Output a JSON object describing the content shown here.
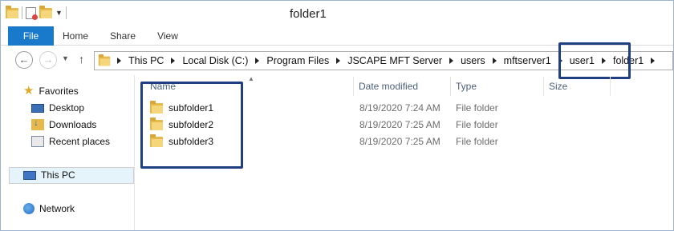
{
  "window": {
    "title": "folder1"
  },
  "ribbon": {
    "tabs": [
      "File",
      "Home",
      "Share",
      "View"
    ]
  },
  "address": {
    "crumbs": [
      "This PC",
      "Local Disk (C:)",
      "Program Files",
      "JSCAPE MFT Server",
      "users",
      "mftserver1",
      "user1",
      "folder1"
    ]
  },
  "sidebar": {
    "favorites": "Favorites",
    "items": [
      "Desktop",
      "Downloads",
      "Recent places"
    ],
    "this_pc": "This PC",
    "network": "Network"
  },
  "columns": {
    "name": "Name",
    "date": "Date modified",
    "type": "Type",
    "size": "Size"
  },
  "files": [
    {
      "name": "subfolder1",
      "date": "8/19/2020 7:24 AM",
      "type": "File folder"
    },
    {
      "name": "subfolder2",
      "date": "8/19/2020 7:25 AM",
      "type": "File folder"
    },
    {
      "name": "subfolder3",
      "date": "8/19/2020 7:25 AM",
      "type": "File folder"
    }
  ],
  "colors": {
    "accent": "#1979ca",
    "highlight_box": "#1f3f82",
    "selection": "#e5f3fb"
  },
  "icons": {
    "folder": "folder-icon",
    "favorites": "star-icon",
    "desktop": "desktop-icon",
    "downloads": "downloads-icon",
    "recent": "recent-places-icon",
    "this_pc": "computer-icon",
    "network": "network-icon"
  }
}
